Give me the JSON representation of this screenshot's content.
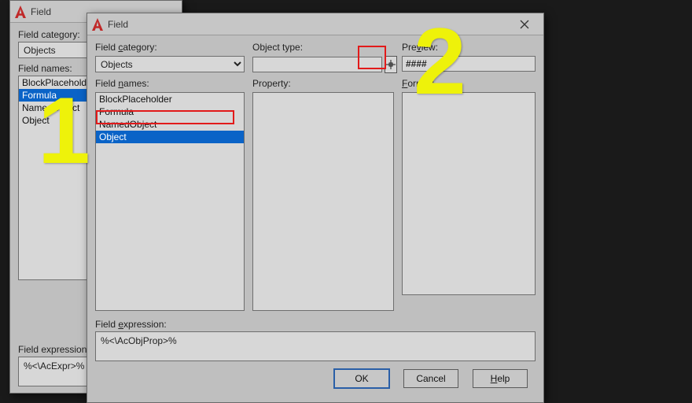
{
  "app": {
    "title": "Field"
  },
  "back": {
    "title": "Field",
    "field_category_label": "Field category:",
    "field_category_value": "Objects",
    "field_names_label": "Field names:",
    "field_names": [
      "BlockPlaceholder",
      "Formula",
      "NamedObject",
      "Object"
    ],
    "field_names_selected": "Formula",
    "field_expression_label": "Field expression:",
    "field_expression_value": "%<\\AcExpr>%"
  },
  "front": {
    "title": "Field",
    "field_category_label": "Field category:",
    "field_category_value": "Objects",
    "field_names_label": "Field names:",
    "field_names": [
      "BlockPlaceholder",
      "Formula",
      "NamedObject",
      "Object"
    ],
    "field_names_selected": "Object",
    "object_type_label": "Object type:",
    "object_type_value": "",
    "property_label": "Property:",
    "preview_label": "Preview:",
    "preview_value": "####",
    "format_label": "Format:",
    "field_expression_label": "Field expression:",
    "field_expression_value": "%<\\AcObjProp>%",
    "ok": "OK",
    "cancel": "Cancel",
    "help": "Help"
  },
  "annotations": {
    "one": "1",
    "two": "2"
  }
}
